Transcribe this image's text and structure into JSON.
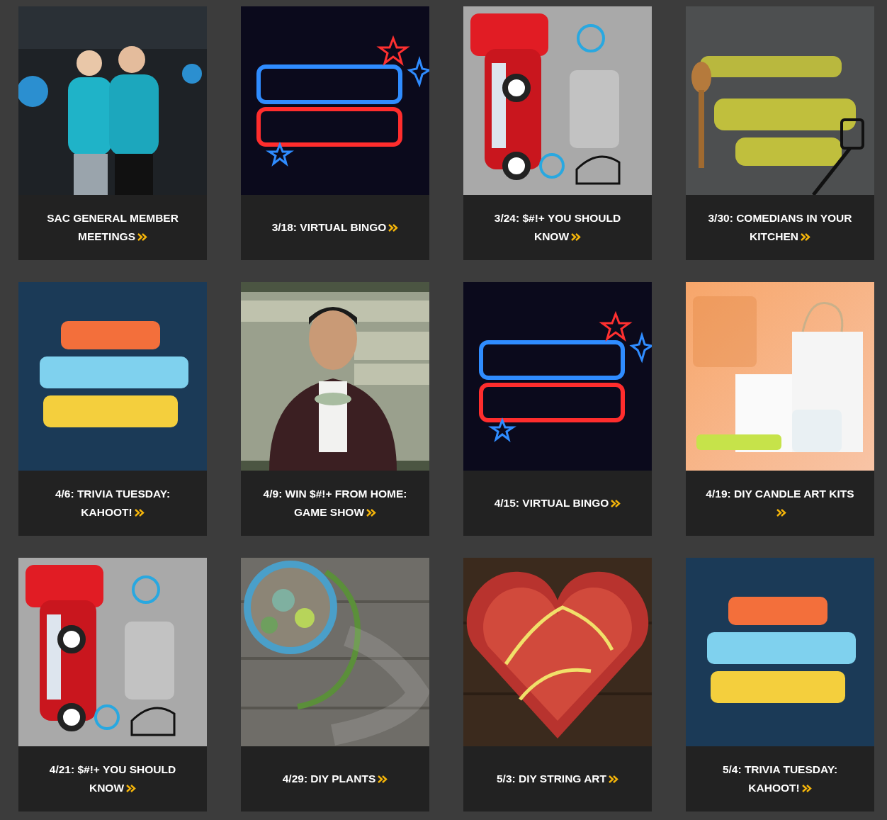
{
  "events": [
    {
      "title": "SAC GENERAL MEMBER MEETINGS"
    },
    {
      "title": "3/18: VIRTUAL BINGO"
    },
    {
      "title": "3/24: $#!+ YOU SHOULD KNOW"
    },
    {
      "title": "3/30: COMEDIANS IN YOUR KITCHEN"
    },
    {
      "title": "4/6: TRIVIA TUESDAY: KAHOOT!"
    },
    {
      "title": "4/9: WIN $#!+ FROM HOME: GAME SHOW"
    },
    {
      "title": "4/15: VIRTUAL BINGO"
    },
    {
      "title": "4/19: DIY CANDLE ART KITS"
    },
    {
      "title": "4/21: $#!+ YOU SHOULD KNOW"
    },
    {
      "title": "4/29: DIY PLANTS"
    },
    {
      "title": "5/3: DIY STRING ART"
    },
    {
      "title": "5/4: TRIVIA TUESDAY: KAHOOT!"
    }
  ]
}
